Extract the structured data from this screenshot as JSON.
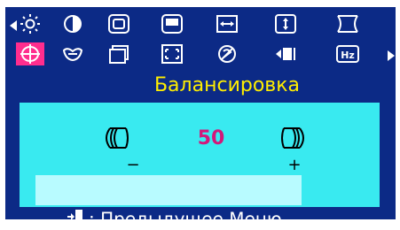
{
  "section_title": "Балансировка",
  "balance": {
    "value": "50",
    "minus": "−",
    "plus": "+"
  },
  "footer": {
    "text": ": Предыдущее Меню"
  },
  "colors": {
    "panel_bg": "#0c2a86",
    "selected_bg": "#ff2d8e",
    "title": "#ffee00",
    "content_bg": "#39eaf0",
    "value": "#d3177a"
  },
  "icons_row1": [
    "brightness-icon",
    "contrast-icon",
    "position-icon",
    "size-icon",
    "horizontal-size-icon",
    "vertical-size-icon",
    "pincushion-icon"
  ],
  "icons_row2": [
    "balance-icon",
    "parallelogram-icon",
    "tilt-icon",
    "zoom-icon",
    "degauss-icon",
    "input-icon",
    "frequency-icon"
  ],
  "selected_icon": "balance-icon"
}
